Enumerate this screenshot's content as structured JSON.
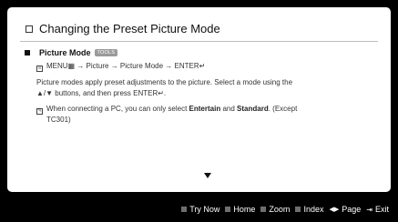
{
  "header": {
    "title": "Changing the Preset Picture Mode"
  },
  "section": {
    "title": "Picture Mode",
    "badge": "TOOLS"
  },
  "menu_path": "MENU▦ → Picture → Picture Mode → ENTER↵",
  "body": {
    "line1": "Picture modes apply preset adjustments to the picture. Select a mode using the",
    "line2": "▲/▼ buttons, and then press ENTER↵."
  },
  "note": {
    "line1_prefix": "When connecting a PC, you can only select",
    "line1_b1": "Entertain",
    "line1_and": "and",
    "line1_b2": "Standard",
    "line1_suffix": ". (Except",
    "line2": "TC301)"
  },
  "footer": {
    "items": [
      {
        "label": "Try Now"
      },
      {
        "label": "Home"
      },
      {
        "label": "Zoom"
      },
      {
        "label": "Index"
      },
      {
        "label": "Page"
      },
      {
        "label": "Exit"
      }
    ]
  },
  "colors": {
    "background": "#000000",
    "page": "#ffffff",
    "footer_text": "#ffffff"
  }
}
